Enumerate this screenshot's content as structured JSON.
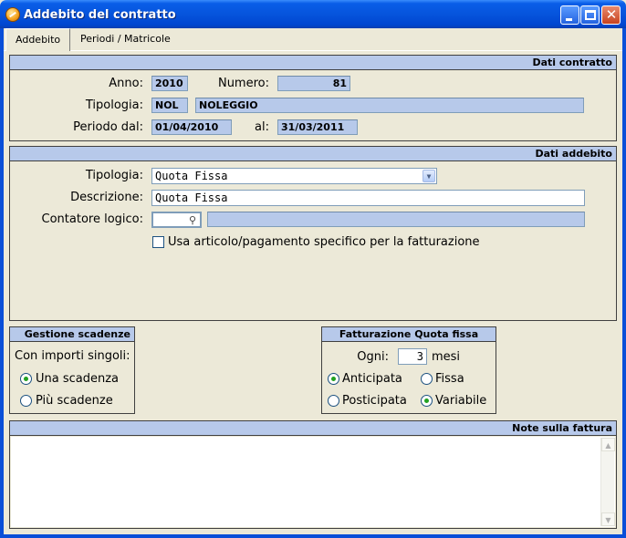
{
  "window": {
    "title": "Addebito del contratto"
  },
  "tabs": [
    {
      "label": "Addebito",
      "active": true
    },
    {
      "label": "Periodi / Matricole",
      "active": false
    }
  ],
  "dati_contratto": {
    "header": "Dati contratto",
    "anno_label": "Anno:",
    "anno": "2010",
    "numero_label": "Numero:",
    "numero": "81",
    "tipologia_label": "Tipologia:",
    "tipologia_code": "NOL",
    "tipologia_desc": "NOLEGGIO",
    "periodo_label": "Periodo dal:",
    "periodo_dal": "01/04/2010",
    "al_label": "al:",
    "periodo_al": "31/03/2011"
  },
  "dati_addebito": {
    "header": "Dati addebito",
    "tipologia_label": "Tipologia:",
    "tipologia_value": "Quota Fissa",
    "descrizione_label": "Descrizione:",
    "descrizione_value": "Quota Fissa",
    "contatore_label": "Contatore logico:",
    "contatore_value": "",
    "contatore_desc": "",
    "usa_articolo_label": "Usa articolo/pagamento specifico per la fatturazione",
    "usa_articolo_checked": false
  },
  "gestione_scadenze": {
    "header": "Gestione scadenze",
    "intro": "Con importi singoli:",
    "options": [
      {
        "label": "Una scadenza",
        "checked": true
      },
      {
        "label": "Più scadenze",
        "checked": false
      }
    ]
  },
  "fatturazione": {
    "header": "Fatturazione Quota fissa",
    "ogni_label": "Ogni:",
    "ogni_value": "3",
    "mesi_label": "mesi",
    "anticipata": "Anticipata",
    "posticipata": "Posticipata",
    "fissa": "Fissa",
    "variabile": "Variabile",
    "selected_timing": "Anticipata",
    "selected_type": "Variabile"
  },
  "note": {
    "header": "Note sulla fattura",
    "text": ""
  },
  "colors": {
    "header_blue": "#b7c9ea",
    "window_bg": "#ece9d8",
    "titlebar": "#0654dc",
    "radio_dot": "#21a121"
  }
}
